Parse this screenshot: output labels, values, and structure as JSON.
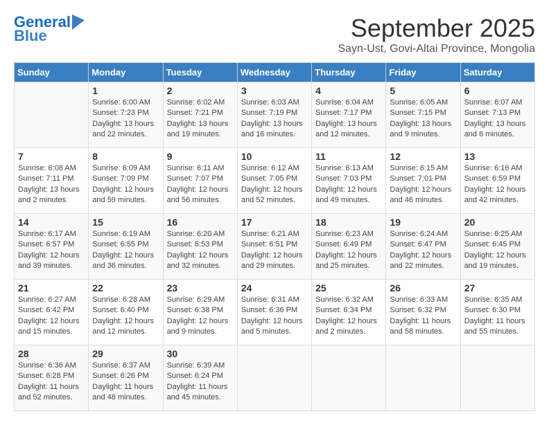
{
  "header": {
    "logo_line1": "General",
    "logo_line2": "Blue",
    "month": "September 2025",
    "location": "Sayn-Ust, Govi-Altai Province, Mongolia"
  },
  "days_of_week": [
    "Sunday",
    "Monday",
    "Tuesday",
    "Wednesday",
    "Thursday",
    "Friday",
    "Saturday"
  ],
  "weeks": [
    [
      {
        "day": "",
        "content": ""
      },
      {
        "day": "1",
        "content": "Sunrise: 6:00 AM\nSunset: 7:23 PM\nDaylight: 13 hours\nand 22 minutes."
      },
      {
        "day": "2",
        "content": "Sunrise: 6:02 AM\nSunset: 7:21 PM\nDaylight: 13 hours\nand 19 minutes."
      },
      {
        "day": "3",
        "content": "Sunrise: 6:03 AM\nSunset: 7:19 PM\nDaylight: 13 hours\nand 16 minutes."
      },
      {
        "day": "4",
        "content": "Sunrise: 6:04 AM\nSunset: 7:17 PM\nDaylight: 13 hours\nand 12 minutes."
      },
      {
        "day": "5",
        "content": "Sunrise: 6:05 AM\nSunset: 7:15 PM\nDaylight: 13 hours\nand 9 minutes."
      },
      {
        "day": "6",
        "content": "Sunrise: 6:07 AM\nSunset: 7:13 PM\nDaylight: 13 hours\nand 6 minutes."
      }
    ],
    [
      {
        "day": "7",
        "content": "Sunrise: 6:08 AM\nSunset: 7:11 PM\nDaylight: 13 hours\nand 2 minutes."
      },
      {
        "day": "8",
        "content": "Sunrise: 6:09 AM\nSunset: 7:09 PM\nDaylight: 12 hours\nand 59 minutes."
      },
      {
        "day": "9",
        "content": "Sunrise: 6:11 AM\nSunset: 7:07 PM\nDaylight: 12 hours\nand 56 minutes."
      },
      {
        "day": "10",
        "content": "Sunrise: 6:12 AM\nSunset: 7:05 PM\nDaylight: 12 hours\nand 52 minutes."
      },
      {
        "day": "11",
        "content": "Sunrise: 6:13 AM\nSunset: 7:03 PM\nDaylight: 12 hours\nand 49 minutes."
      },
      {
        "day": "12",
        "content": "Sunrise: 6:15 AM\nSunset: 7:01 PM\nDaylight: 12 hours\nand 46 minutes."
      },
      {
        "day": "13",
        "content": "Sunrise: 6:16 AM\nSunset: 6:59 PM\nDaylight: 12 hours\nand 42 minutes."
      }
    ],
    [
      {
        "day": "14",
        "content": "Sunrise: 6:17 AM\nSunset: 6:57 PM\nDaylight: 12 hours\nand 39 minutes."
      },
      {
        "day": "15",
        "content": "Sunrise: 6:19 AM\nSunset: 6:55 PM\nDaylight: 12 hours\nand 36 minutes."
      },
      {
        "day": "16",
        "content": "Sunrise: 6:20 AM\nSunset: 6:53 PM\nDaylight: 12 hours\nand 32 minutes."
      },
      {
        "day": "17",
        "content": "Sunrise: 6:21 AM\nSunset: 6:51 PM\nDaylight: 12 hours\nand 29 minutes."
      },
      {
        "day": "18",
        "content": "Sunrise: 6:23 AM\nSunset: 6:49 PM\nDaylight: 12 hours\nand 25 minutes."
      },
      {
        "day": "19",
        "content": "Sunrise: 6:24 AM\nSunset: 6:47 PM\nDaylight: 12 hours\nand 22 minutes."
      },
      {
        "day": "20",
        "content": "Sunrise: 6:25 AM\nSunset: 6:45 PM\nDaylight: 12 hours\nand 19 minutes."
      }
    ],
    [
      {
        "day": "21",
        "content": "Sunrise: 6:27 AM\nSunset: 6:42 PM\nDaylight: 12 hours\nand 15 minutes."
      },
      {
        "day": "22",
        "content": "Sunrise: 6:28 AM\nSunset: 6:40 PM\nDaylight: 12 hours\nand 12 minutes."
      },
      {
        "day": "23",
        "content": "Sunrise: 6:29 AM\nSunset: 6:38 PM\nDaylight: 12 hours\nand 9 minutes."
      },
      {
        "day": "24",
        "content": "Sunrise: 6:31 AM\nSunset: 6:36 PM\nDaylight: 12 hours\nand 5 minutes."
      },
      {
        "day": "25",
        "content": "Sunrise: 6:32 AM\nSunset: 6:34 PM\nDaylight: 12 hours\nand 2 minutes."
      },
      {
        "day": "26",
        "content": "Sunrise: 6:33 AM\nSunset: 6:32 PM\nDaylight: 11 hours\nand 58 minutes."
      },
      {
        "day": "27",
        "content": "Sunrise: 6:35 AM\nSunset: 6:30 PM\nDaylight: 11 hours\nand 55 minutes."
      }
    ],
    [
      {
        "day": "28",
        "content": "Sunrise: 6:36 AM\nSunset: 6:28 PM\nDaylight: 11 hours\nand 52 minutes."
      },
      {
        "day": "29",
        "content": "Sunrise: 6:37 AM\nSunset: 6:26 PM\nDaylight: 11 hours\nand 48 minutes."
      },
      {
        "day": "30",
        "content": "Sunrise: 6:39 AM\nSunset: 6:24 PM\nDaylight: 11 hours\nand 45 minutes."
      },
      {
        "day": "",
        "content": ""
      },
      {
        "day": "",
        "content": ""
      },
      {
        "day": "",
        "content": ""
      },
      {
        "day": "",
        "content": ""
      }
    ]
  ]
}
